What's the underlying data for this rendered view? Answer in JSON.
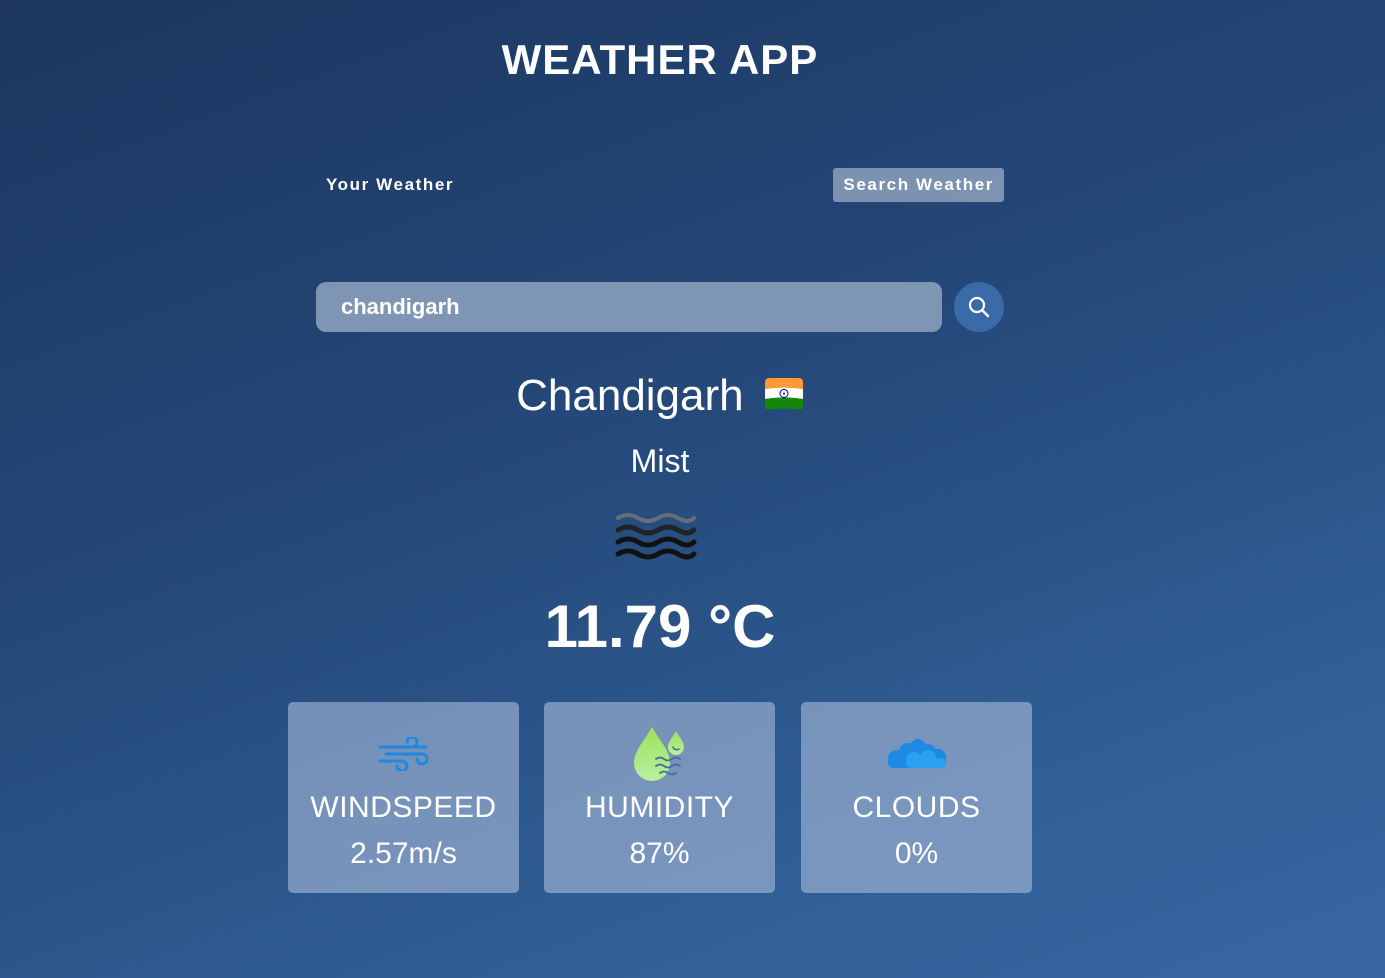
{
  "app": {
    "title": "WEATHER APP"
  },
  "tabs": [
    {
      "label": "Your Weather",
      "active": false
    },
    {
      "label": "Search Weather",
      "active": true
    }
  ],
  "search": {
    "value": "chandigarh",
    "placeholder": "",
    "button_icon": "search-icon"
  },
  "weather": {
    "city": "Chandigarh",
    "country_flag_icon": "india-flag-icon",
    "condition": "Mist",
    "condition_icon": "mist-icon",
    "temperature": "11.79 °C"
  },
  "stats": [
    {
      "label": "WINDSPEED",
      "value": "2.57m/s",
      "icon": "wind-icon"
    },
    {
      "label": "HUMIDITY",
      "value": "87%",
      "icon": "humidity-icon"
    },
    {
      "label": "CLOUDS",
      "value": "0%",
      "icon": "cloud-icon"
    }
  ],
  "colors": {
    "background_top": "#1c3660",
    "background_bottom": "#3867a3",
    "search_button": "#3b6aa8",
    "card_background": "#a0b4d4"
  }
}
